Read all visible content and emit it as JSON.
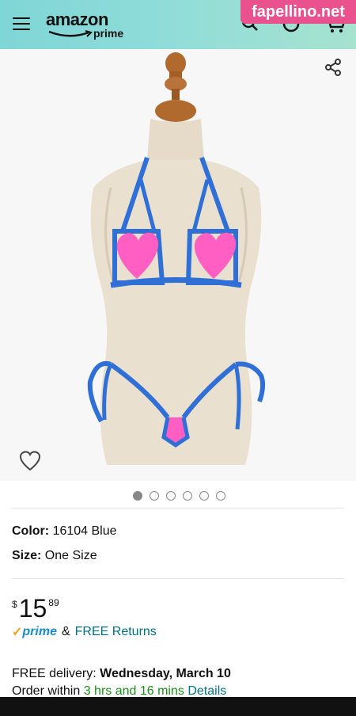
{
  "header": {
    "logo_text": "amazon",
    "logo_sub": "prime",
    "watermark": "fapellino.net",
    "icons": [
      "menu-icon",
      "search-icon",
      "alexa-icon",
      "cart-icon"
    ]
  },
  "gallery": {
    "image_count": 6,
    "active_index": 0,
    "icons": [
      "share-icon",
      "heart-icon"
    ]
  },
  "details": {
    "color_label": "Color:",
    "color_value": "16104 Blue",
    "size_label": "Size:",
    "size_value": "One Size"
  },
  "price": {
    "symbol": "$",
    "whole": "15",
    "fraction": "89"
  },
  "shipping": {
    "check": "✓",
    "prime": "prime",
    "amp": "&",
    "returns": "FREE Returns"
  },
  "delivery": {
    "label": "FREE delivery:",
    "date": "Wednesday, March 10",
    "order_prefix": "Order within",
    "order_time": "3 hrs and 16 mins",
    "details_link": "Details"
  },
  "colors": {
    "header_start": "#7fd6d6",
    "header_end": "#a6e3cf",
    "watermark": "#e9528f",
    "link": "#007185",
    "green": "#1a8f1a",
    "prime_blue": "#1b8ccb",
    "prime_orange": "#f0a21b"
  }
}
